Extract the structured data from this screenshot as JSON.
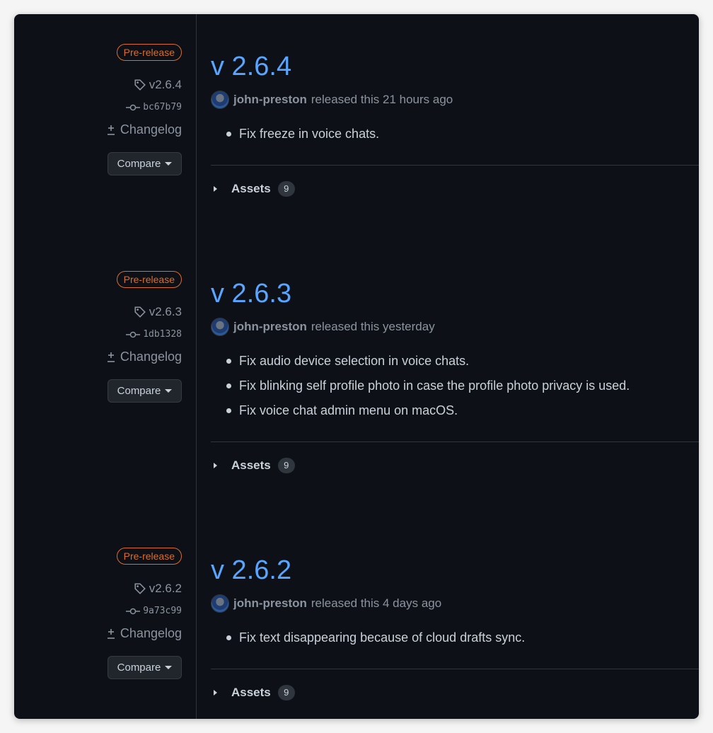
{
  "releases": [
    {
      "badge": "Pre-release",
      "tag": "v2.6.4",
      "commit": "bc67b79",
      "changelog": "Changelog",
      "compare": "Compare",
      "version": "v 2.6.4",
      "author": "john-preston",
      "released": "released this 21 hours ago",
      "notes": [
        "Fix freeze in voice chats."
      ],
      "assets_label": "Assets",
      "assets_count": "9"
    },
    {
      "badge": "Pre-release",
      "tag": "v2.6.3",
      "commit": "1db1328",
      "changelog": "Changelog",
      "compare": "Compare",
      "version": "v 2.6.3",
      "author": "john-preston",
      "released": "released this yesterday",
      "notes": [
        "Fix audio device selection in voice chats.",
        "Fix blinking self profile photo in case the profile photo privacy is used.",
        "Fix voice chat admin menu on macOS."
      ],
      "assets_label": "Assets",
      "assets_count": "9"
    },
    {
      "badge": "Pre-release",
      "tag": "v2.6.2",
      "commit": "9a73c99",
      "changelog": "Changelog",
      "compare": "Compare",
      "version": "v 2.6.2",
      "author": "john-preston",
      "released": "released this 4 days ago",
      "notes": [
        "Fix text disappearing because of cloud drafts sync."
      ],
      "assets_label": "Assets",
      "assets_count": "9"
    }
  ],
  "colors": {
    "background": "#0d1117",
    "link": "#58a6ff",
    "prerelease": "#db6d28",
    "muted": "#8b949e"
  }
}
